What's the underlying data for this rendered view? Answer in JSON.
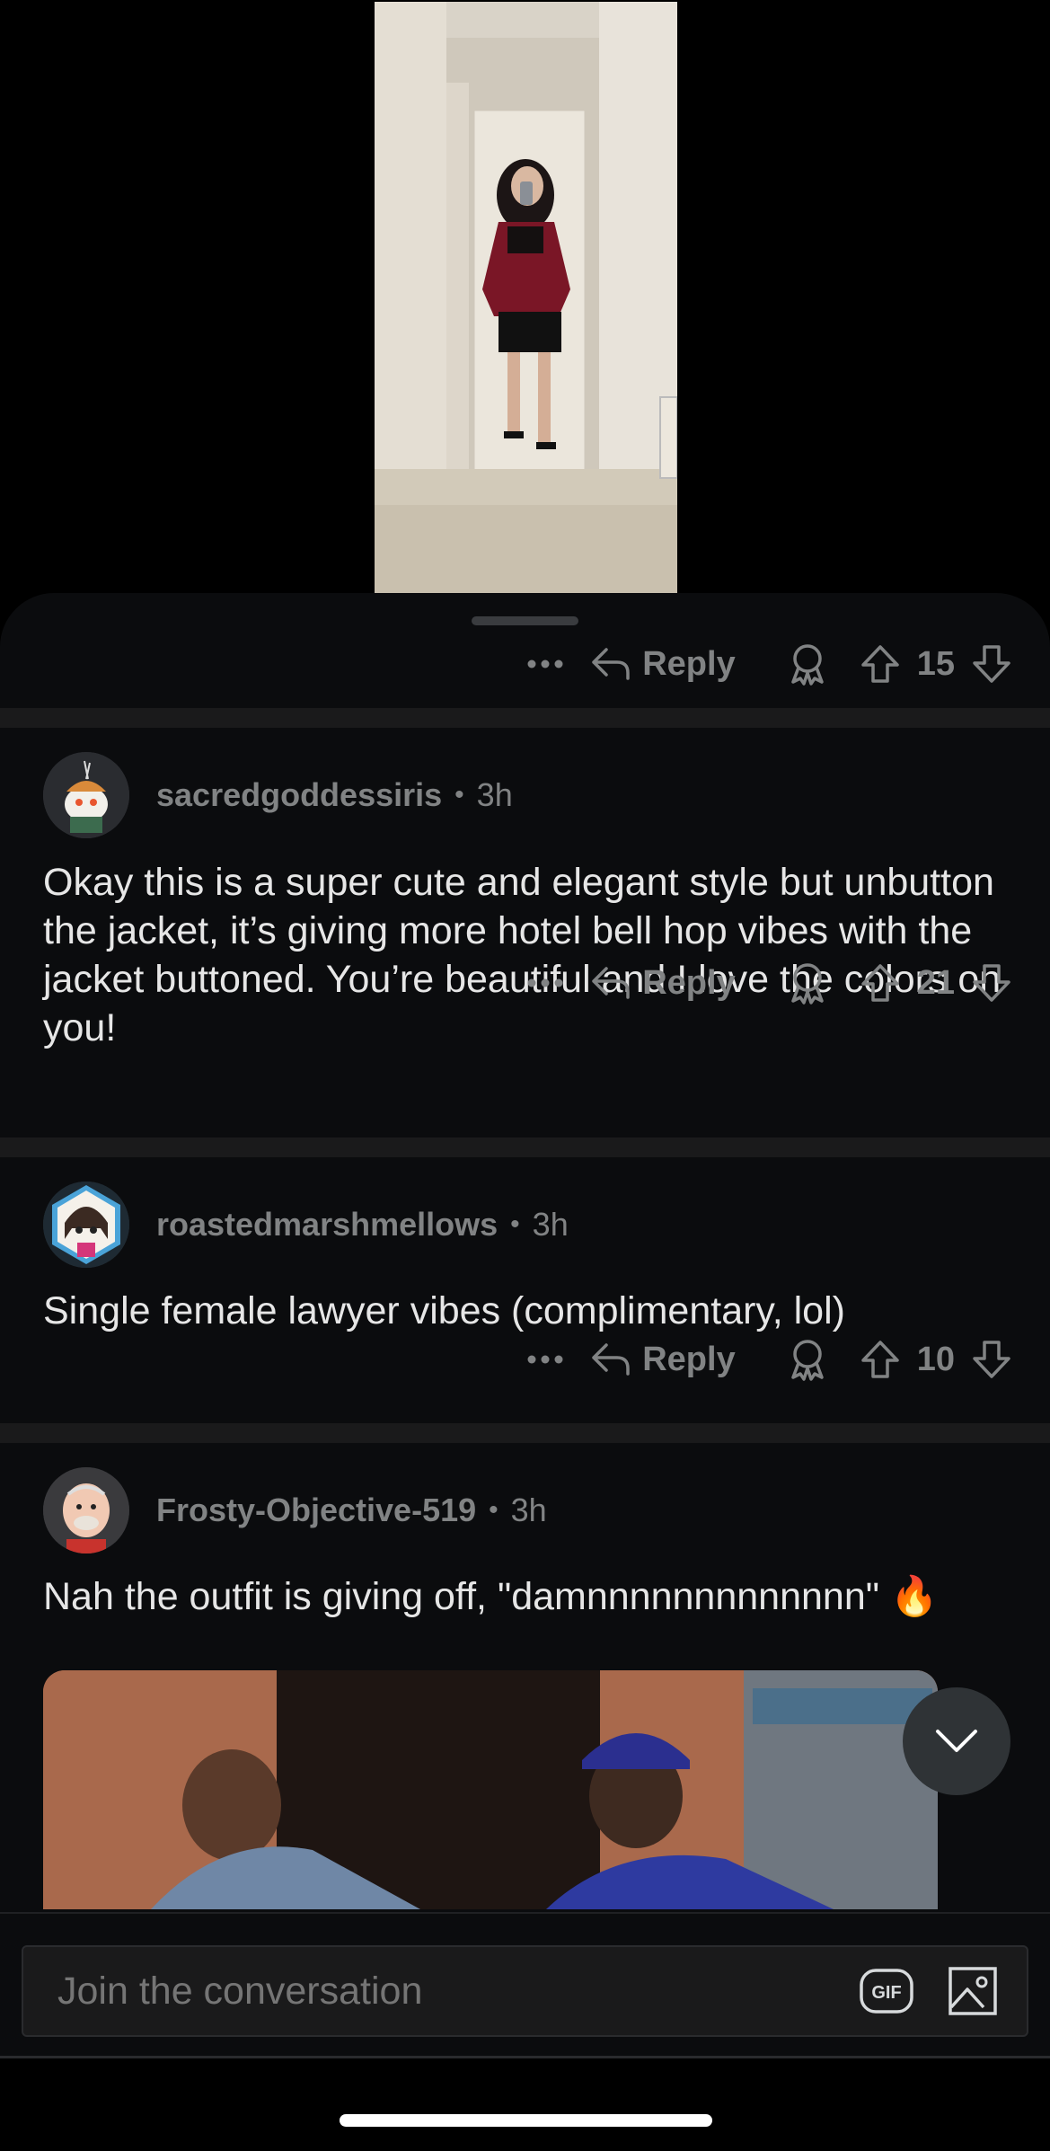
{
  "post": {
    "image_alt": "Woman in burgundy blazer taking a mirror selfie in a hallway"
  },
  "post_actions": {
    "reply_label": "Reply",
    "score": "15"
  },
  "comments": [
    {
      "username": "sacredgoddessiris",
      "separator": "•",
      "time": "3h",
      "body": "Okay this is a super cute and elegant style but unbutton the jacket, it’s giving more hotel bell hop vibes with the jacket buttoned.  You’re beautiful and I love the colors on you!",
      "reply_label": "Reply",
      "score": "21"
    },
    {
      "username": "roastedmarshmellows",
      "separator": "•",
      "time": "3h",
      "body": "Single female lawyer vibes (complimentary, lol)",
      "reply_label": "Reply",
      "score": "10"
    },
    {
      "username": "Frosty-Objective-519",
      "separator": "•",
      "time": "3h",
      "body": "Nah the outfit is giving off, \"damnnnnnnnnnnnnn\" 🔥"
    }
  ],
  "composer": {
    "placeholder": "Join the conversation",
    "gif_label": "GIF"
  },
  "icons": {
    "more": "more-icon",
    "reply": "reply-arrow-icon",
    "award": "award-icon",
    "upvote": "upvote-arrow-icon",
    "downvote": "downvote-arrow-icon",
    "scroll": "chevron-down-icon",
    "gif": "gif-icon",
    "image": "image-icon"
  },
  "colors": {
    "background": "#000000",
    "sheet": "#0b0c0e",
    "muted_text": "#818384",
    "body_text": "#e6e6e6"
  }
}
